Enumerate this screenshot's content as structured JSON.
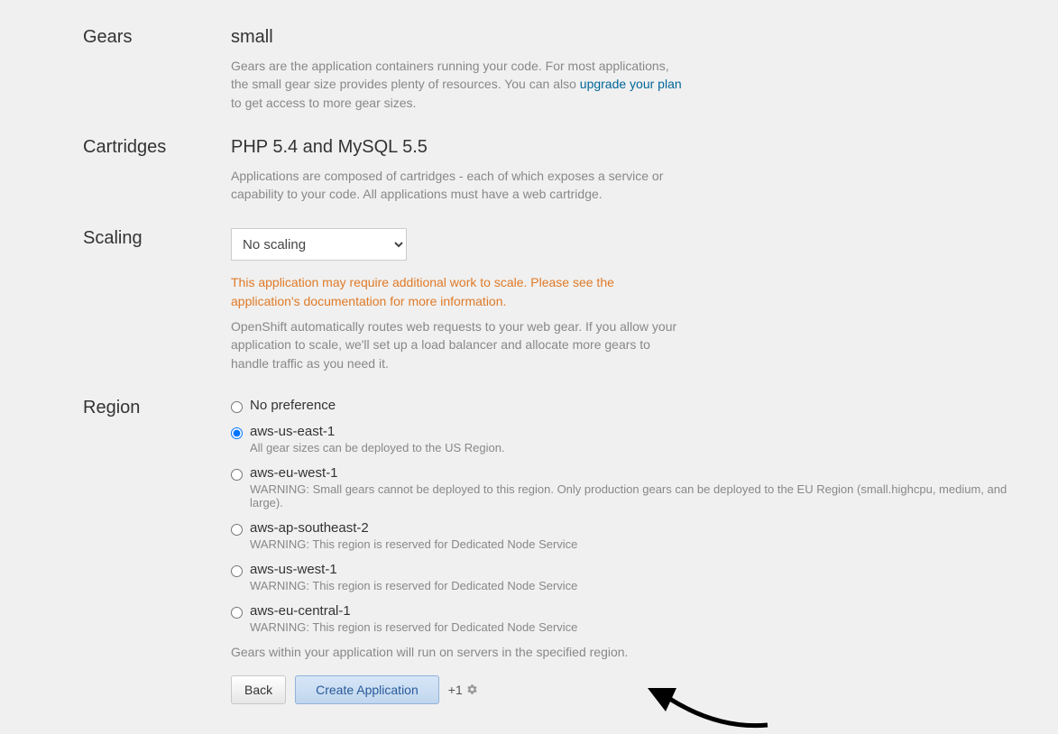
{
  "gears": {
    "label": "Gears",
    "value": "small",
    "desc_1": "Gears are the application containers running your code. For most applications, the small gear size provides plenty of resources. You can also ",
    "link_text": "upgrade your plan",
    "desc_2": " to get access to more gear sizes."
  },
  "cartridges": {
    "label": "Cartridges",
    "value": "PHP 5.4 and MySQL 5.5",
    "desc": "Applications are composed of cartridges - each of which exposes a service or capability to your code. All applications must have a web cartridge."
  },
  "scaling": {
    "label": "Scaling",
    "selected": "No scaling",
    "warning": "This application may require additional work to scale. Please see the application's documentation for more information.",
    "desc": "OpenShift automatically routes web requests to your web gear. If you allow your application to scale, we'll set up a load balancer and allocate more gears to handle traffic as you need it."
  },
  "region": {
    "label": "Region",
    "options": [
      {
        "value": "No preference",
        "desc": "",
        "checked": false
      },
      {
        "value": "aws-us-east-1",
        "desc": "All gear sizes can be deployed to the US Region.",
        "checked": true
      },
      {
        "value": "aws-eu-west-1",
        "desc": "WARNING: Small gears cannot be deployed to this region. Only production gears can be deployed to the EU Region (small.highcpu, medium, and large).",
        "checked": false
      },
      {
        "value": "aws-ap-southeast-2",
        "desc": "WARNING: This region is reserved for Dedicated Node Service",
        "checked": false
      },
      {
        "value": "aws-us-west-1",
        "desc": "WARNING: This region is reserved for Dedicated Node Service",
        "checked": false
      },
      {
        "value": "aws-eu-central-1",
        "desc": "WARNING: This region is reserved for Dedicated Node Service",
        "checked": false
      }
    ],
    "footer": "Gears within your application will run on servers in the specified region."
  },
  "buttons": {
    "back": "Back",
    "create": "Create Application",
    "badge": "+1"
  }
}
